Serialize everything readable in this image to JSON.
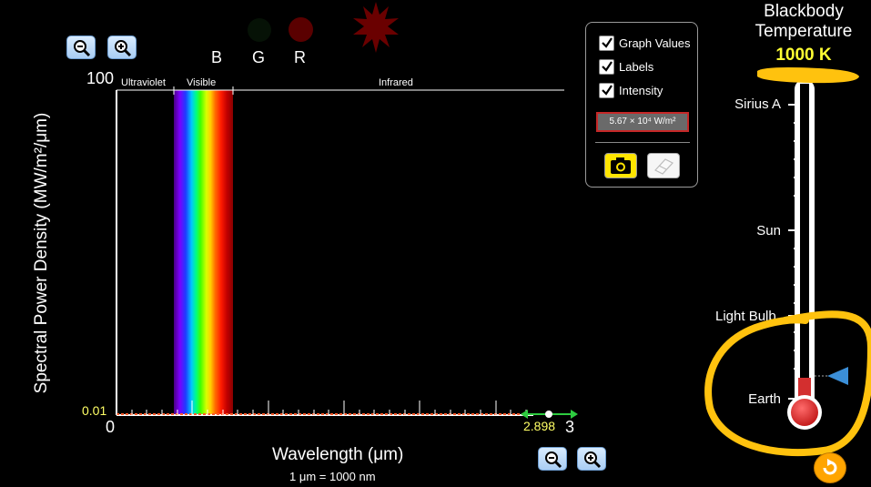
{
  "title": {
    "line1": "Blackbody",
    "line2": "Temperature",
    "temperature": "1000 K"
  },
  "star_markers": {
    "b": "B",
    "g": "G",
    "r": "R"
  },
  "graph": {
    "y_max": "100",
    "y_min": "0.01",
    "x_min": "0",
    "x_max": "3",
    "peak_value": "2.898",
    "band_ultraviolet": "Ultraviolet",
    "band_visible": "Visible",
    "band_infrared": "Infrared",
    "y_axis_label": "Spectral Power Density (MW/m²/μm)",
    "x_axis_label": "Wavelength (μm)",
    "unit_note": "1 μm  =  1000 nm"
  },
  "controls": {
    "graph_values": "Graph Values",
    "labels": "Labels",
    "intensity": "Intensity",
    "intensity_value": "5.67 × 10⁴ W/m²"
  },
  "thermometer": {
    "sirius": "Sirius A",
    "sun": "Sun",
    "light_bulb": "Light Bulb",
    "earth": "Earth",
    "level_fraction": 0.05
  },
  "colors": {
    "temperature_text": "#ffff33",
    "highlight": "#ffc20e",
    "mercury": "#d32f2f",
    "axis_yellow": "#ffff66",
    "peak_green": "#2ecc40"
  }
}
